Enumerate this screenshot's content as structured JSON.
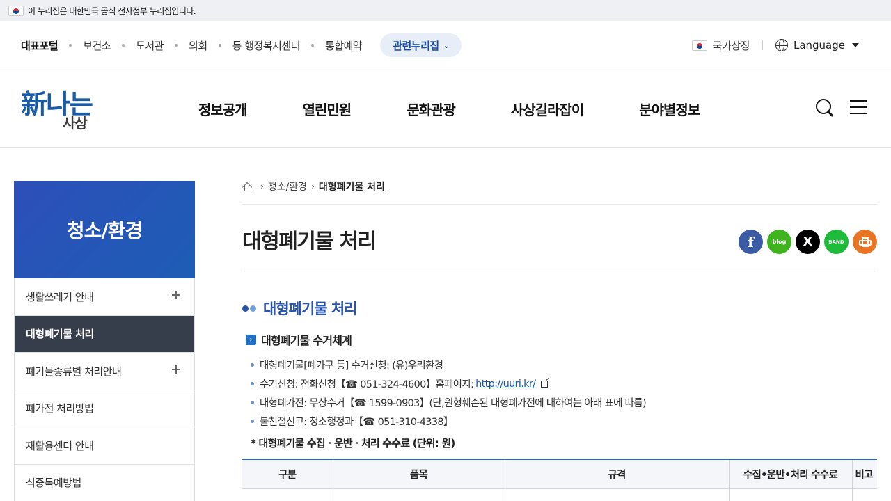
{
  "gov_banner": {
    "text": "이 누리집은 대한민국 공식 전자정부 누리집입니다."
  },
  "top_links": {
    "items": [
      "대표포털",
      "보건소",
      "도서관",
      "의회",
      "동 행정복지센터",
      "통합예약"
    ],
    "related_label": "관련누리집",
    "national_symbol": "국가상징",
    "language": "Language"
  },
  "logo": {
    "main": "新나는",
    "sub": "사상"
  },
  "gnb": {
    "items": [
      "정보공개",
      "열린민원",
      "문화관광",
      "사상길라잡이",
      "분야별정보"
    ]
  },
  "side": {
    "title": "청소/환경",
    "items": [
      {
        "label": "생활쓰레기 안내",
        "has_sub": true
      },
      {
        "label": "대형폐기물 처리",
        "active": true
      },
      {
        "label": "폐기물종류별 처리안내",
        "has_sub": true
      },
      {
        "label": "폐가전 처리방법"
      },
      {
        "label": "재활용센터 안내"
      },
      {
        "label": "식중독예방법"
      }
    ]
  },
  "breadcrumb": {
    "level1": "청소/환경",
    "current": "대형폐기물 처리"
  },
  "page": {
    "title": "대형폐기물 처리",
    "share": {
      "facebook": "f",
      "blog": "blog",
      "x": "X",
      "band": "BAND"
    },
    "h2": "대형폐기물 처리",
    "h3": "대형폐기물 수거체계",
    "bullets": {
      "b1": "대형폐기물[폐가구 등] 수거신청: (유)우리환경",
      "b2_prefix": "수거신청: 전화신청【☎ 051-324-4600】홈페이지:",
      "b2_link": "http://uuri.kr/",
      "b3": "대형폐가전: 무상수거【☎ 1599-0903】(단,원형훼손된 대형폐가전에 대하여는 아래 표에 따름)",
      "b4": "불친절신고: 청소행정과【☎ 051-310-4338】"
    },
    "note": "* 대형폐기물 수집ㆍ운반ㆍ처리 수수료 (단위: 원)",
    "table": {
      "headers": [
        "구분",
        "품목",
        "규격",
        "수집•운반•처리 수수료",
        "비고"
      ]
    }
  }
}
